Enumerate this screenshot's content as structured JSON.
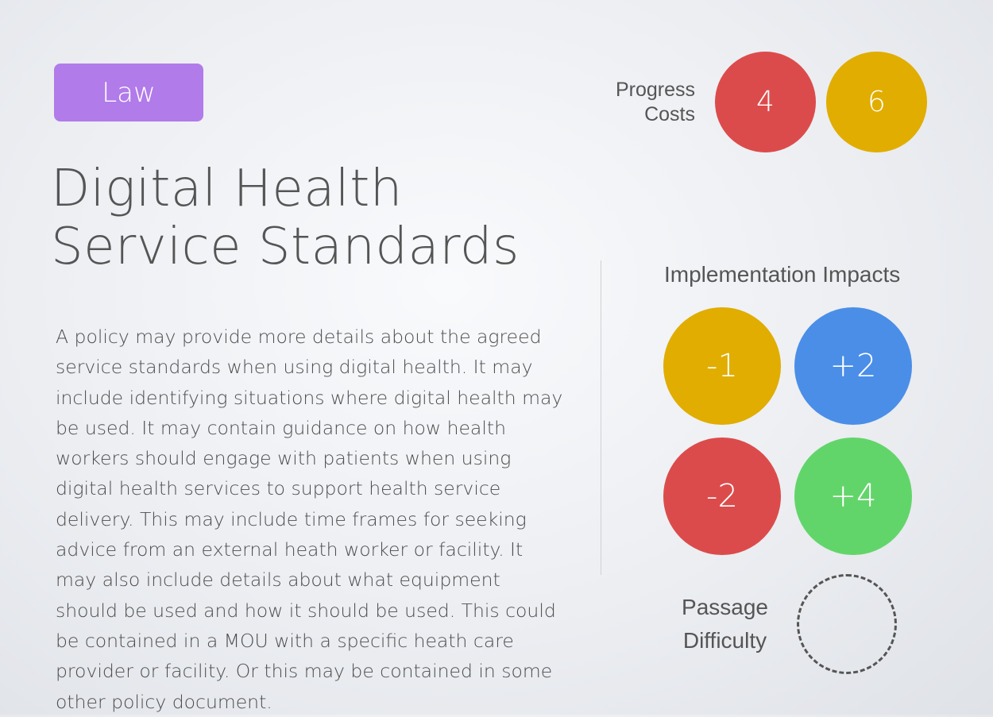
{
  "tag": {
    "label": "Law",
    "color": "#b17bea"
  },
  "progress_costs": {
    "label_line1": "Progress",
    "label_line2": "Costs",
    "circles": [
      {
        "value": "4",
        "color": "#dc4b4b"
      },
      {
        "value": "6",
        "color": "#e0ad00"
      }
    ]
  },
  "title": "Digital Health Service Standards",
  "description": "A policy may provide more details about the agreed service standards when using digital health. It may include identifying situations where digital health may be used. It may contain guidance on how health workers should engage with patients when using digital health services to support health service delivery. This may include time frames for seeking advice from an external heath worker or facility. It may also include details about what equipment should be used and how it should be used. This could be contained in a MOU with a specific heath care provider or facility. Or this may be contained in some other policy document.",
  "implementation_impacts": {
    "label": "Implementation Impacts",
    "circles": [
      {
        "value": "-1",
        "color": "#e0ad00"
      },
      {
        "value": "+2",
        "color": "#4a8ee8"
      },
      {
        "value": "-2",
        "color": "#dc4b4b"
      },
      {
        "value": "+4",
        "color": "#62d56a"
      }
    ]
  },
  "passage_difficulty": {
    "label_line1": "Passage",
    "label_line2": "Difficulty"
  }
}
